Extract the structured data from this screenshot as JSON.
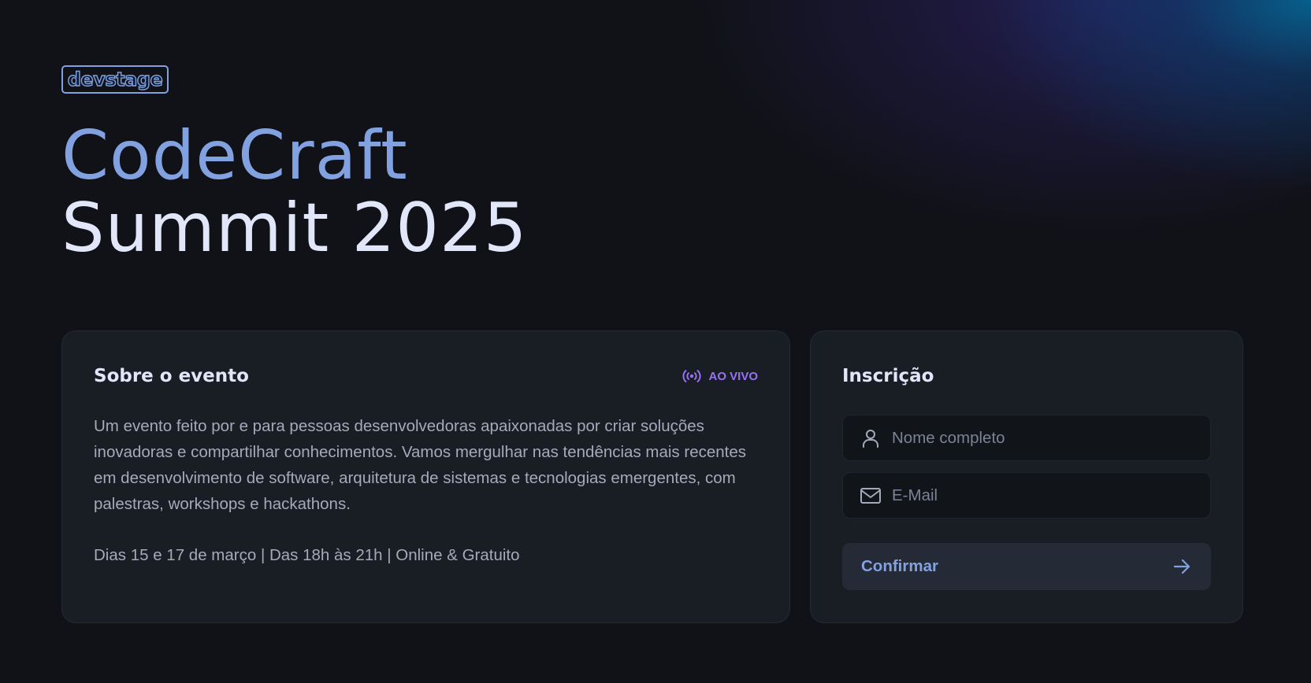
{
  "brand": {
    "logo_text": "devstage"
  },
  "hero": {
    "title_line1": "CodeCraft",
    "title_line2": "Summit 2025"
  },
  "about": {
    "heading": "Sobre o evento",
    "live_badge": "AO VIVO",
    "description": "Um evento feito por e para pessoas desenvolvedoras apaixonadas por criar soluções inovadoras e compartilhar conhecimentos. Vamos mergulhar nas tendências mais recentes em desenvolvimento de software, arquitetura de sistemas e tecnologias emergentes, com palestras, workshops e hackathons.",
    "schedule": "Dias 15 e 17 de março | Das 18h às 21h | Online & Gratuito"
  },
  "registration": {
    "heading": "Inscrição",
    "name_field": {
      "placeholder": "Nome completo",
      "value": ""
    },
    "email_field": {
      "placeholder": "E-Mail",
      "value": ""
    },
    "confirm_label": "Confirmar"
  },
  "icons": {
    "live": "radio-broadcast-icon",
    "name": "user-icon",
    "email": "mail-icon",
    "confirm": "arrow-right-icon"
  },
  "colors": {
    "background": "#101217",
    "accent_blue": "#81a1e0",
    "accent_purple": "#9871f5",
    "card": "#191d24",
    "text_primary": "#e1e6f9",
    "text_muted": "#a4aabb"
  }
}
